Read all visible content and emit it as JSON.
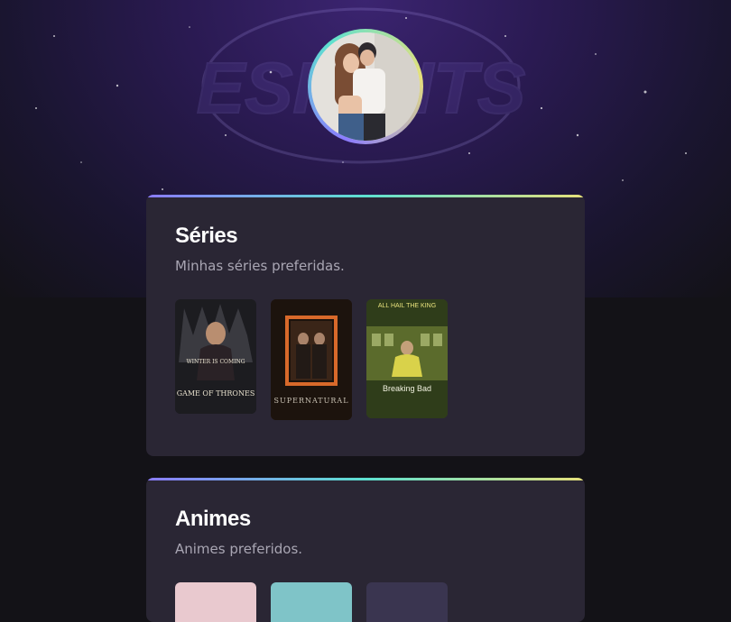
{
  "profile": {
    "avatar_alt": "couple photo"
  },
  "sections": [
    {
      "title": "Séries",
      "subtitle": "Minhas séries preferidas.",
      "posters": [
        {
          "name": "Game of Thrones",
          "tagline": "WINTER IS COMING",
          "title_text": "GAME OF THRONES",
          "color": "#1e1e22"
        },
        {
          "name": "Supernatural",
          "title_text": "SUPERNATURAL",
          "color": "#2b1a12"
        },
        {
          "name": "Breaking Bad",
          "tagline": "ALL HAIL THE KING",
          "title_text": "Breaking Bad",
          "color": "#6b7a2a"
        }
      ]
    },
    {
      "title": "Animes",
      "subtitle": "Animes preferidos.",
      "posters": [
        {
          "name": "anime-1",
          "color": "#e9c9cf"
        },
        {
          "name": "anime-2",
          "color": "#7fc4c8"
        },
        {
          "name": "anime-3",
          "color": "#3a3550"
        }
      ]
    }
  ],
  "colors": {
    "accent_start": "#8b7bff",
    "accent_mid": "#5de0d0",
    "accent_end": "#e6e07a",
    "card_bg": "#2a2634",
    "page_bg": "#131217"
  }
}
